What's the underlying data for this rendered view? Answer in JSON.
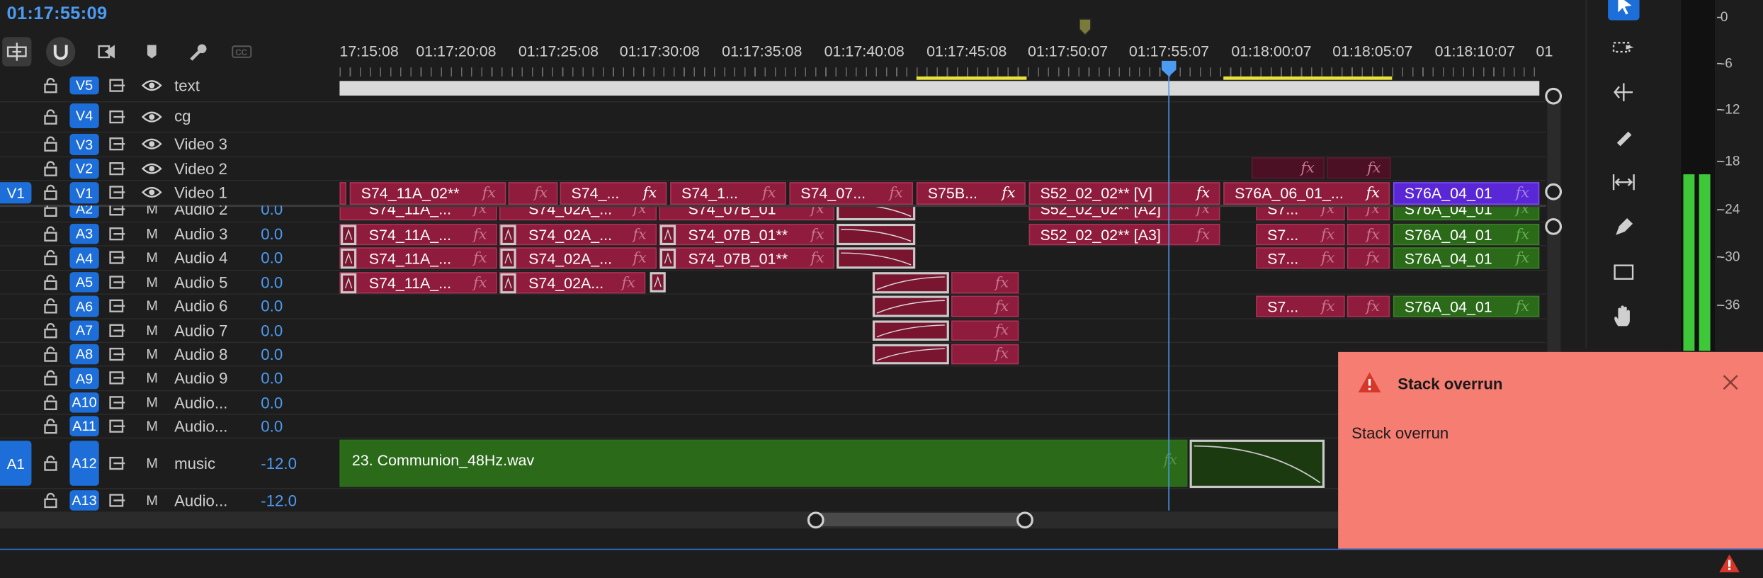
{
  "timecode": "01:17:55:09",
  "ruler_labels": [
    "17:15:08",
    "01:17:20:08",
    "01:17:25:08",
    "01:17:30:08",
    "01:17:35:08",
    "01:17:40:08",
    "01:17:45:08",
    "01:17:50:07",
    "01:17:55:07",
    "01:18:00:07",
    "01:18:05:07",
    "01:18:10:07",
    "01"
  ],
  "tracks": {
    "v5": {
      "target": "V5",
      "name": "text"
    },
    "v4": {
      "target": "V4",
      "name": "cg"
    },
    "v3": {
      "target": "V3",
      "name": "Video 3"
    },
    "v2": {
      "target": "V2",
      "name": "Video 2"
    },
    "v1": {
      "source": "V1",
      "target": "V1",
      "name": "Video 1"
    },
    "a2": {
      "target": "A2",
      "name": "Audio 2",
      "volume": "0.0"
    },
    "a3": {
      "target": "A3",
      "name": "Audio 3",
      "volume": "0.0"
    },
    "a4": {
      "target": "A4",
      "name": "Audio 4",
      "volume": "0.0"
    },
    "a5": {
      "target": "A5",
      "name": "Audio 5",
      "volume": "0.0"
    },
    "a6": {
      "target": "A6",
      "name": "Audio 6",
      "volume": "0.0"
    },
    "a7": {
      "target": "A7",
      "name": "Audio 7",
      "volume": "0.0"
    },
    "a8": {
      "target": "A8",
      "name": "Audio 8",
      "volume": "0.0"
    },
    "a9": {
      "target": "A9",
      "name": "Audio 9",
      "volume": "0.0"
    },
    "a10": {
      "target": "A10",
      "name": "Audio...",
      "volume": "0.0"
    },
    "a11": {
      "target": "A11",
      "name": "Audio...",
      "volume": "0.0"
    },
    "a12": {
      "source": "A1",
      "target": "A12",
      "name": "music",
      "volume": "-12.0"
    },
    "a13": {
      "target": "A13",
      "name": "Audio...",
      "volume": "-12.0"
    }
  },
  "mute_label": "M",
  "fx_label": "fx",
  "clips": {
    "v1_1": "S74_11A_02**",
    "v1_2": "S74_...",
    "v1_3": "S74_1...",
    "v1_4": "S74_07...",
    "v1_5": "S75B...",
    "v1_6": "S52_02_02** [V]",
    "v1_7": "S76A_06_01_...",
    "v1_8": "S76A_04_01",
    "a2_1": "S74_11A_...",
    "a2_2": "S74_02A_...",
    "a2_3": "S74_07B_01",
    "a2_4": "S52_02_02** [A2]",
    "a2_5": "S7...",
    "a2_6": "S76A_04_01",
    "a3_1": "S74_11A_...",
    "a3_2": "S74_02A_...",
    "a3_3": "S74_07B_01**",
    "a3_4": "S52_02_02** [A3]",
    "a3_5": "S7...",
    "a3_6": "S76A_04_01",
    "a4_1": "S74_11A_...",
    "a4_2": "S74_02A_...",
    "a4_3": "S74_07B_01**",
    "a4_5": "S7...",
    "a4_6": "S76A_04_01",
    "a5_1": "S74_11A_...",
    "a5_2": "S74_02A...",
    "a6_5": "S7...",
    "a6_6": "S76A_04_01",
    "music": "23. Communion_48Hz.wav"
  },
  "meter_ticks": [
    "0",
    "-6",
    "-12",
    "-18",
    "-24",
    "-30",
    "-36"
  ],
  "notification": {
    "title": "Stack overrun",
    "body": "Stack overrun"
  },
  "colors": {
    "accent": "#1d6ed8",
    "timecode": "#4c9bf2",
    "clip_video": "#8f1c3d",
    "clip_green": "#2a6a18",
    "clip_purple": "#5a27d6",
    "toast": "#f57d72",
    "meter": "#3fc73a"
  }
}
